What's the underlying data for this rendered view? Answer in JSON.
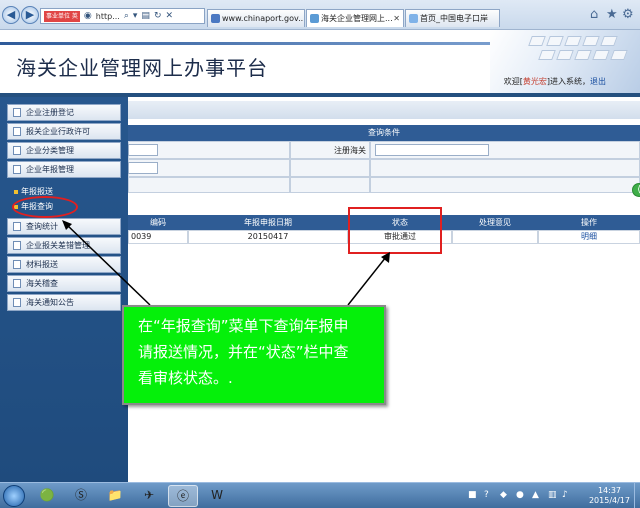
{
  "browser": {
    "address_badge": "事业单位 英",
    "address_text": "http...",
    "tabs": [
      {
        "label": "www.chinaport.gov...."
      },
      {
        "label": "海关企业管理网上..."
      },
      {
        "label": "首页_中国电子口岸"
      }
    ],
    "icons": {
      "back": "back-arrow-icon",
      "forward": "forward-arrow-icon",
      "home": "home-icon",
      "favorites": "star-icon",
      "settings": "gear-icon"
    }
  },
  "header": {
    "site_title": "海关企业管理网上办事平台",
    "welcome_prefix": "欢迎[",
    "user_name": "黄光宏",
    "welcome_suffix": "]进入系统，",
    "logout": "退出"
  },
  "sidebar": {
    "items": [
      {
        "label": "企业注册登记"
      },
      {
        "label": "报关企业行政许可"
      },
      {
        "label": "企业分类管理"
      },
      {
        "label": "企业年报管理"
      },
      {
        "label": "查询统计"
      },
      {
        "label": "企业报关差错管理"
      },
      {
        "label": "材料报送"
      },
      {
        "label": "海关稽查"
      },
      {
        "label": "海关通知公告"
      }
    ],
    "sub_items": [
      {
        "label": "年报报送"
      },
      {
        "label": "年报查询"
      }
    ]
  },
  "query": {
    "header": "查询条件",
    "customs_label": "注册海关"
  },
  "results": {
    "columns": [
      "编码",
      "年报申报日期",
      "状态",
      "处理意见",
      "操作"
    ],
    "rows": [
      {
        "code": "0039",
        "date": "20150417",
        "status": "审批通过",
        "opinion": "",
        "action": "明细"
      }
    ]
  },
  "annotation": {
    "line1": "在“年报查询”菜单下查询年报申",
    "line2": "请报送情况，并在“状态”栏中查",
    "line3": "看审核状态。.",
    "highlight_color": "#e02020",
    "callout_color": "#05f00a"
  },
  "taskbar": {
    "time": "14:37",
    "date": "2015/4/17"
  }
}
